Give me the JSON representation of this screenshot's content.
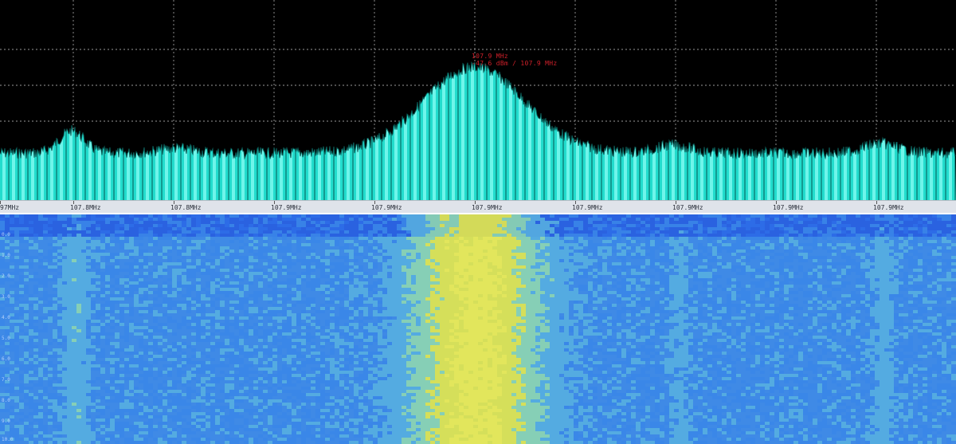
{
  "spectrum": {
    "trace_color": "#22dccd",
    "trace_highlight": "#6ff5ea",
    "background": "#000000",
    "grid": "dotted-white",
    "peak_marker": {
      "line1": "107.9 MHz",
      "line2": "-47.6 dBm / 107.9 MHz",
      "color": "#d0202a"
    }
  },
  "frequency_axis": {
    "labels": [
      "97MHz",
      "107.8MHz",
      "107.8MHz",
      "107.9MHz",
      "107.9MHz",
      "107.9MHz",
      "107.9MHz",
      "107.9MHz",
      "107.9MHz",
      "107.9MHz"
    ]
  },
  "waterfall": {
    "colormap": [
      "#2e6ee8",
      "#3a86e8",
      "#56aee0",
      "#8ed6b0",
      "#e6e84a",
      "#f4f04c"
    ],
    "time_labels": [
      "0.0",
      "1.0",
      "2.0",
      "3.0",
      "4.0",
      "5.0",
      "6.0",
      "7.0",
      "8.0",
      "9.0",
      "10.0"
    ]
  }
}
